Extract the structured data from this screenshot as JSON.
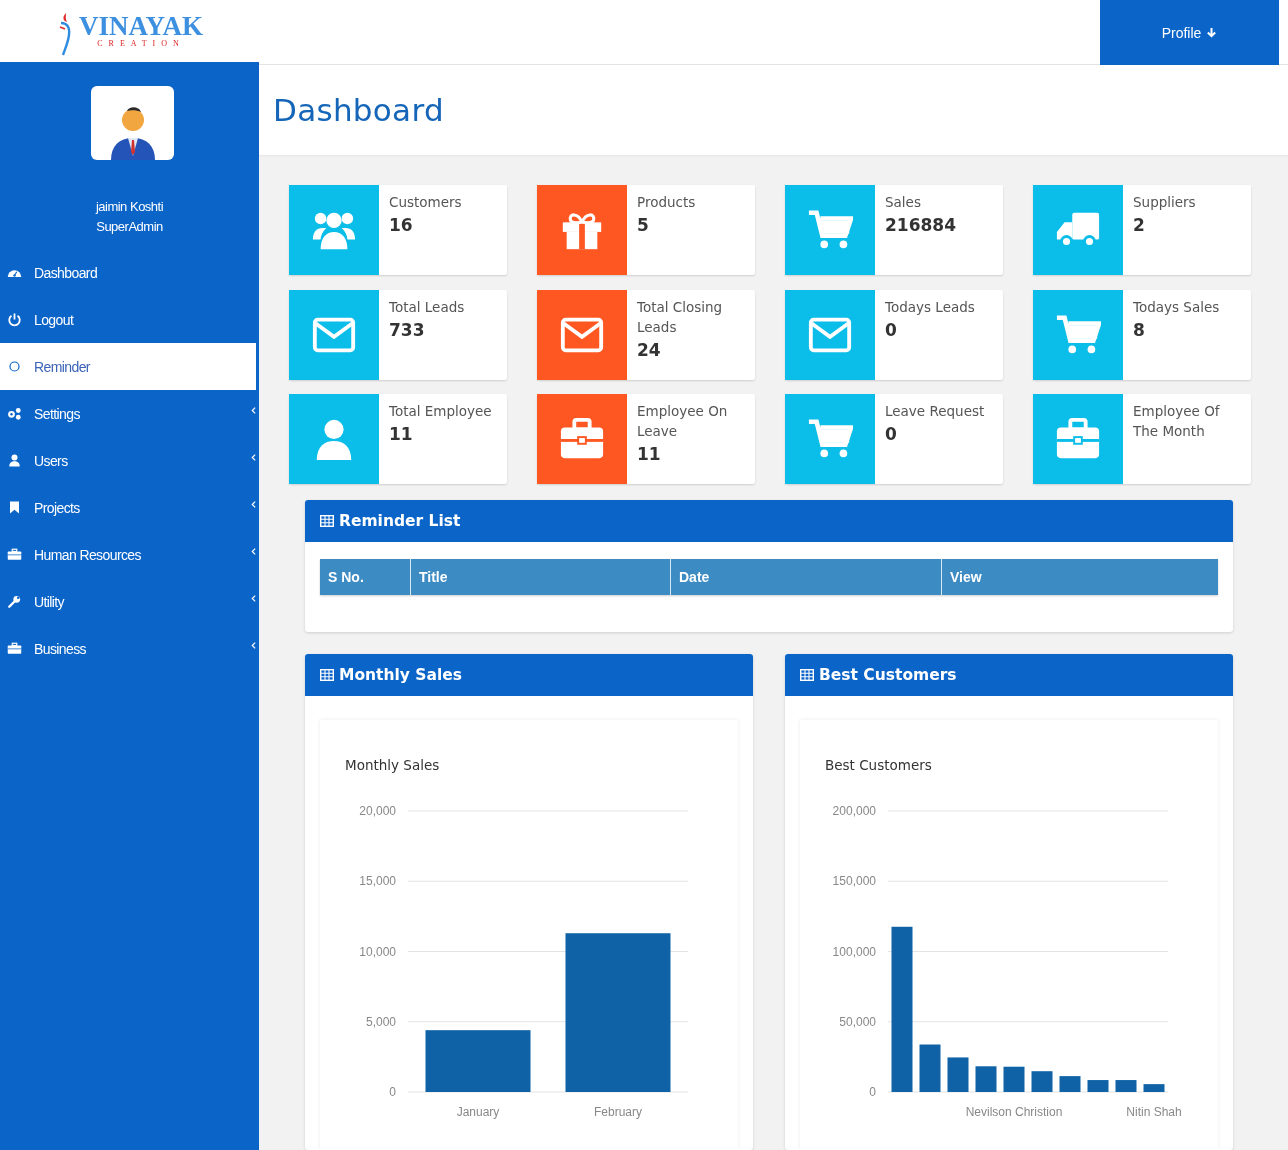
{
  "logo": {
    "name": "VINAYAK",
    "tagline": "CREATION"
  },
  "profile_button": {
    "label": "Profile"
  },
  "user": {
    "name": "jaimin Koshti",
    "role": "SuperAdmin"
  },
  "sidebar": {
    "items": [
      {
        "label": "Dashboard",
        "kind": "link",
        "selected": false
      },
      {
        "label": "Logout",
        "kind": "link",
        "selected": false
      },
      {
        "label": "Reminder",
        "kind": "link",
        "selected": true
      },
      {
        "label": "Settings",
        "kind": "submenu",
        "selected": false,
        "expanded": false
      },
      {
        "label": "Users",
        "kind": "submenu",
        "selected": false,
        "expanded": false
      },
      {
        "label": "Projects",
        "kind": "submenu",
        "selected": false,
        "expanded": false
      },
      {
        "label": "Human Resources",
        "kind": "submenu",
        "selected": false,
        "expanded": false
      },
      {
        "label": "Utility",
        "kind": "submenu",
        "selected": false,
        "expanded": false
      },
      {
        "label": "Business",
        "kind": "submenu",
        "selected": false,
        "expanded": false
      }
    ]
  },
  "page_title": "Dashboard",
  "stats": [
    {
      "label": "Customers",
      "value": "16",
      "color": "#0bbde9"
    },
    {
      "label": "Products",
      "value": "5",
      "color": "#fe5722"
    },
    {
      "label": "Sales",
      "value": "216884",
      "color": "#0bbde9"
    },
    {
      "label": "Suppliers",
      "value": "2",
      "color": "#0bbde9"
    },
    {
      "label": "Total Leads",
      "value": "733",
      "color": "#0bbde9"
    },
    {
      "label": "Total Closing Leads",
      "value": "24",
      "color": "#fe5722"
    },
    {
      "label": "Todays Leads",
      "value": "0",
      "color": "#0bbde9"
    },
    {
      "label": "Todays Sales",
      "value": "8",
      "color": "#0bbde9"
    },
    {
      "label": "Total Employee",
      "value": "11",
      "color": "#0bbde9"
    },
    {
      "label": "Employee On Leave",
      "value": "11",
      "color": "#fe5722"
    },
    {
      "label": "Leave Request",
      "value": "0",
      "color": "#0bbde9"
    },
    {
      "label": "Employee Of The Month",
      "color": "#0bbde9"
    }
  ],
  "reminder_list": {
    "title": "Reminder List",
    "columns": [
      "S No.",
      "Title",
      "Date",
      "View"
    ]
  },
  "chart_panels": [
    {
      "title": "Monthly Sales",
      "chart_data": {
        "type": "bar",
        "title": "Monthly Sales",
        "categories": [
          "January",
          "February"
        ],
        "grid": true,
        "series": [
          {
            "color": "#0e62a5",
            "values": [
              4400,
              11300
            ]
          }
        ],
        "ylim": [
          0,
          20000
        ],
        "yticks": [
          {
            "value": 0,
            "label": "0"
          },
          {
            "value": 5000,
            "label": "5,000"
          },
          {
            "value": 10000,
            "label": "10,000"
          },
          {
            "value": 15000,
            "label": "15,000"
          },
          {
            "value": 20000,
            "label": "20,000"
          }
        ]
      }
    },
    {
      "title": "Best Customers",
      "chart_data": {
        "type": "bar",
        "title": "Best Customers",
        "categories": [
          null,
          null,
          null,
          null,
          "Nevilson Christion",
          null,
          null,
          null,
          null,
          "Nitin Shah"
        ],
        "grid": true,
        "series": [
          {
            "color": "#0e62a5",
            "values": [
              117600,
              33800,
              24600,
              18300,
              18000,
              14800,
              11300,
              8500,
              8500,
              5600
            ]
          }
        ],
        "ylim": [
          0,
          200000
        ],
        "yticks": [
          {
            "value": 0,
            "label": "0"
          },
          {
            "value": 50000,
            "label": "50,000"
          },
          {
            "value": 100000,
            "label": "100,000"
          },
          {
            "value": 150000,
            "label": "150,000"
          },
          {
            "value": 200000,
            "label": "200,000"
          }
        ]
      }
    }
  ]
}
